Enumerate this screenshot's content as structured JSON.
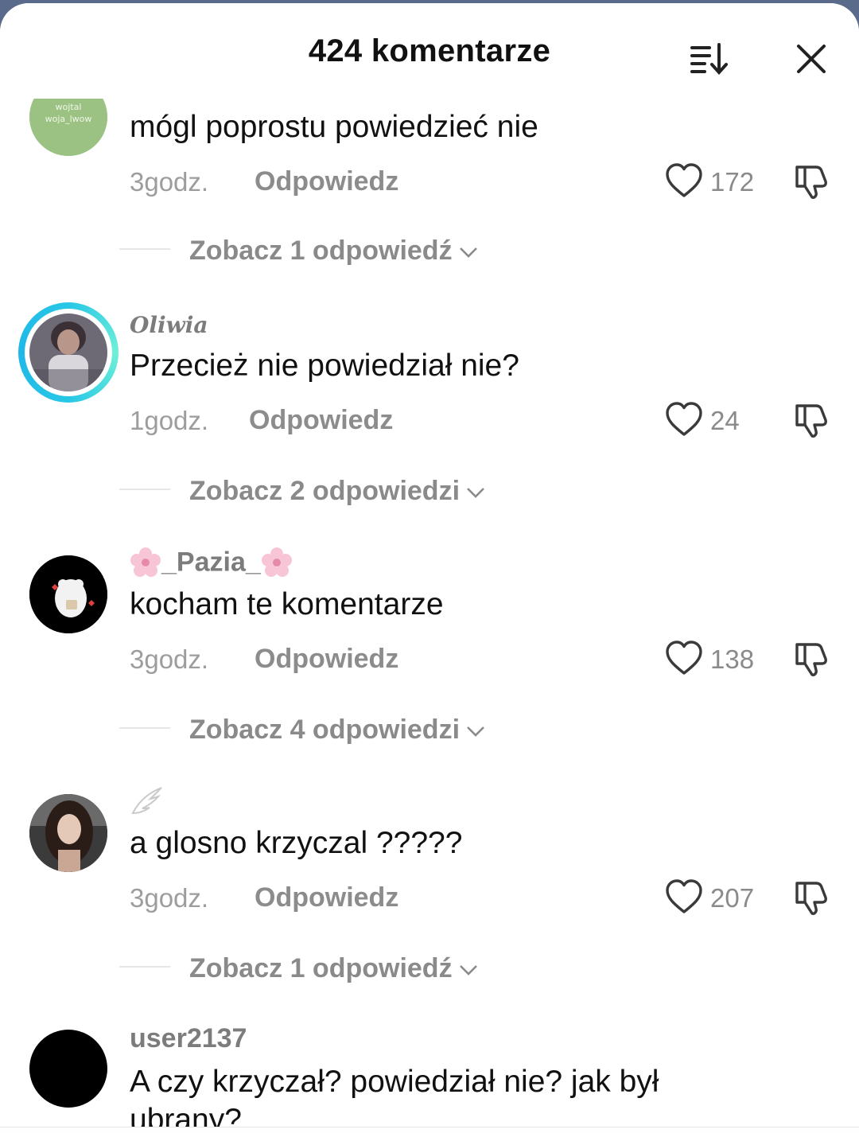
{
  "header": {
    "title": "424 komentarze"
  },
  "comments": [
    {
      "username": "",
      "text": "mógl poprostu powiedzieć nie",
      "time": "3godz.",
      "reply": "Odpowiedz",
      "likes": "172",
      "view_replies": "Zobacz 1 odpowiedź"
    },
    {
      "username": "Oliwia",
      "text": "Przecież nie powiedział nie?",
      "time": "1godz.",
      "reply": "Odpowiedz",
      "likes": "24",
      "view_replies": "Zobacz 2 odpowiedzi"
    },
    {
      "username": "_Pazia_",
      "text": "kocham te komentarze",
      "time": "3godz.",
      "reply": "Odpowiedz",
      "likes": "138",
      "view_replies": "Zobacz 4 odpowiedzi"
    },
    {
      "username": "",
      "text": "a glosno krzyczal ?????",
      "time": "3godz.",
      "reply": "Odpowiedz",
      "likes": "207",
      "view_replies": "Zobacz 1 odpowiedź"
    },
    {
      "username": "user2137",
      "text_line1": "A czy krzyczał? powiedział nie? jak był",
      "text_line2": "ubrany?"
    }
  ],
  "colors": {
    "story_ring": "#27c7e6",
    "text": "#111111",
    "muted": "#8a8a8a"
  }
}
